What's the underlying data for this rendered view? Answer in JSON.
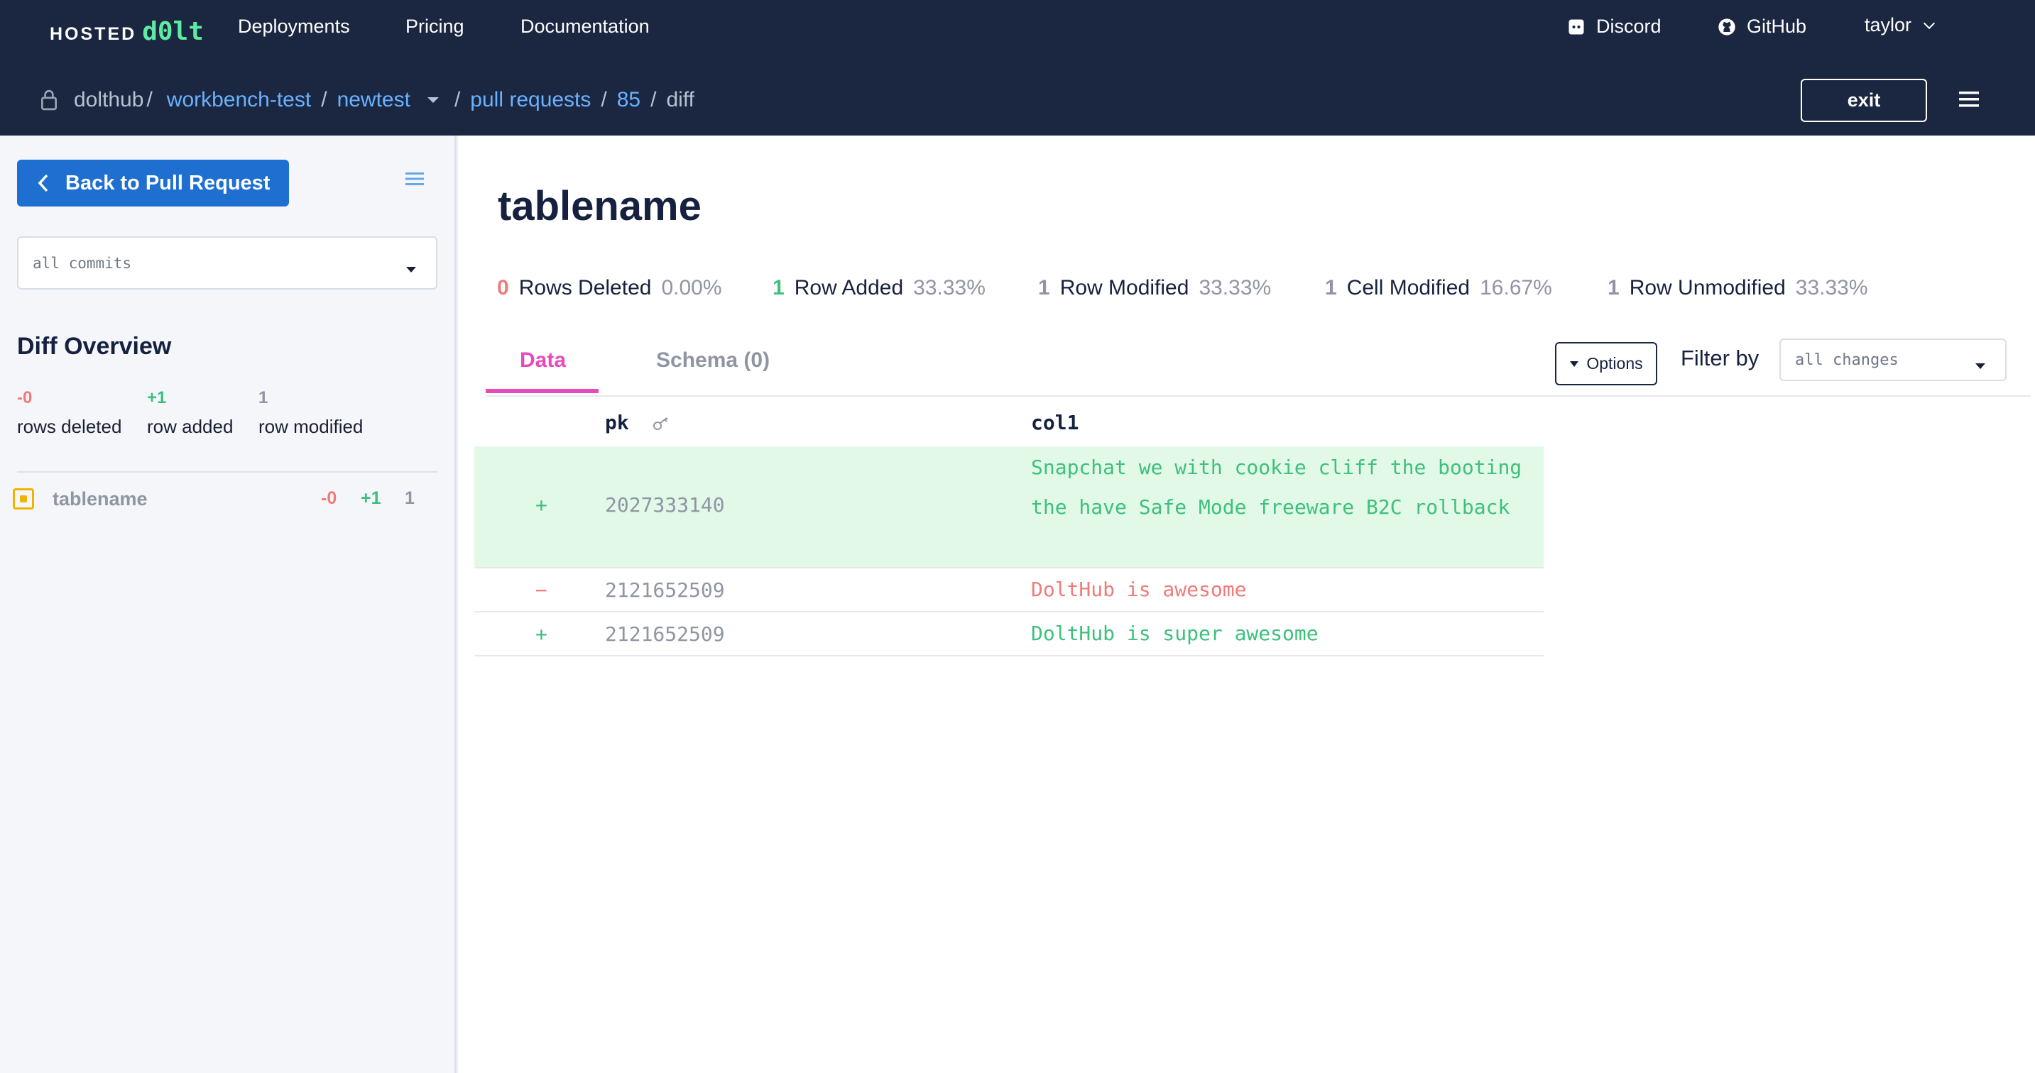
{
  "header": {
    "logo_hosted": "HOSTED",
    "logo_dolt": "d0lt",
    "nav": [
      "Deployments",
      "Pricing",
      "Documentation"
    ],
    "discord": "Discord",
    "github": "GitHub",
    "user": "taylor",
    "exit": "exit"
  },
  "breadcrumb": {
    "owner": "dolthub",
    "owner_sep": "/",
    "database": "workbench-test",
    "branch": "newtest",
    "pulls": "pull requests",
    "pr_number": "85",
    "page": "diff",
    "sep": "/"
  },
  "sidebar": {
    "back_label": "Back to Pull Request",
    "commit_select": "all commits",
    "overview_title": "Diff Overview",
    "overview": {
      "deleted_num": "-0",
      "deleted_label": "rows deleted",
      "added_num": "+1",
      "added_label": "row added",
      "modified_num": "1",
      "modified_label": "row modified"
    },
    "tables": [
      {
        "name": "tablename",
        "deleted": "-0",
        "added": "+1",
        "modified": "1"
      }
    ]
  },
  "main": {
    "table_title": "tablename",
    "stats": [
      {
        "num": "0",
        "label": "Rows Deleted",
        "pct": "0.00%",
        "color": "#f07b7b"
      },
      {
        "num": "1",
        "label": "Row Added",
        "pct": "33.33%",
        "color": "#3ec07d"
      },
      {
        "num": "1",
        "label": "Row Modified",
        "pct": "33.33%",
        "color": "#8f96a3"
      },
      {
        "num": "1",
        "label": "Cell Modified",
        "pct": "16.67%",
        "color": "#8f96a3"
      },
      {
        "num": "1",
        "label": "Row Unmodified",
        "pct": "33.33%",
        "color": "#8f96a3"
      }
    ],
    "tabs": [
      {
        "label": "Data",
        "active": true
      },
      {
        "label": "Schema (0)",
        "active": false
      }
    ],
    "options_label": "Options",
    "filter_label": "Filter by",
    "filter_value": "all changes",
    "columns": [
      "pk",
      "col1"
    ],
    "rows": [
      {
        "mark": "+",
        "pk": "2027333140",
        "col1": "Snapchat we with cookie cliff the booting the have Safe Mode freeware B2C rollback",
        "type": "added"
      },
      {
        "mark": "−",
        "pk": "2121652509",
        "col1": "DoltHub is awesome",
        "type": "removed"
      },
      {
        "mark": "+",
        "pk": "2121652509",
        "col1": "DoltHub is super awesome",
        "type": "modified-new"
      }
    ]
  },
  "colors": {
    "header_bg": "#1b2640",
    "link_blue": "#69b2ff",
    "button_blue": "#1f6fd1",
    "accent_pink": "#e74bbb",
    "added_green": "#3ec07d",
    "deleted_red": "#f07b7b"
  }
}
